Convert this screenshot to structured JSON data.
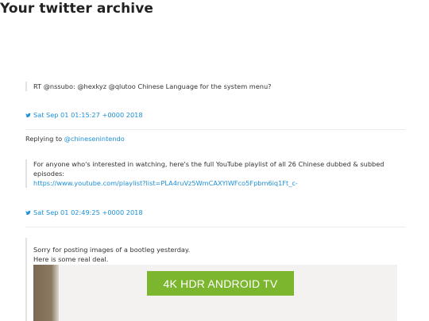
{
  "page": {
    "title": "Your twitter archive"
  },
  "tweets": [
    {
      "text": "RT @nssubo: @hexkyz @qlutoo Chinese Language for the system menu?",
      "timestamp": "Sat Sep 01 01:15:27 +0000 2018"
    },
    {
      "reply_prefix": "Replying to ",
      "reply_to": "@chinesenintendo",
      "text": "For anyone who's interested in watching, here's the full YouTube playlist of all 26 Chinese dubbed & subbed episodes:",
      "link": "https://www.youtube.com/playlist?list=PLA4ruVz5WmCAXYlWFco5Fpbm6iq1Ft_c-",
      "timestamp": "Sat Sep 01 02:49:25 +0000 2018"
    },
    {
      "text": "Sorry for posting images of a bootleg yesterday.\nHere is some real deal.",
      "image_text": "4K HDR ANDROID TV"
    }
  ],
  "colors": {
    "link": "#1d8fd6",
    "banner": "#7cb62f",
    "border": "#e2e2e2"
  },
  "icons": {
    "timestamp": "twitter-bird-icon"
  }
}
